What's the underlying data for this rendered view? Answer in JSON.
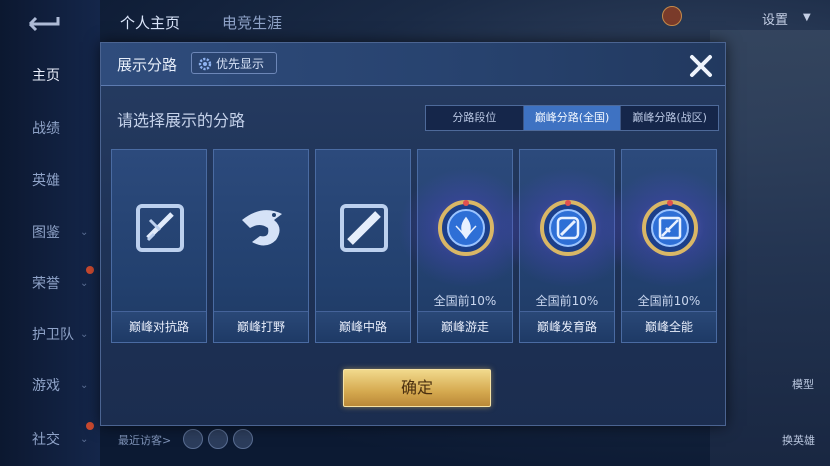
{
  "sidebar": {
    "items": [
      {
        "label": "主页",
        "active": true,
        "chevron": false,
        "dot": false
      },
      {
        "label": "战绩",
        "active": false,
        "chevron": false,
        "dot": false
      },
      {
        "label": "英雄",
        "active": false,
        "chevron": false,
        "dot": false
      },
      {
        "label": "图鉴",
        "active": false,
        "chevron": true,
        "dot": false
      },
      {
        "label": "荣誉",
        "active": false,
        "chevron": true,
        "dot": true
      },
      {
        "label": "护卫队",
        "active": false,
        "chevron": true,
        "dot": false
      },
      {
        "label": "游戏",
        "active": false,
        "chevron": true,
        "dot": false
      },
      {
        "label": "社交",
        "active": false,
        "chevron": true,
        "dot": true
      }
    ]
  },
  "top_tabs": [
    {
      "label": "个人主页",
      "active": true
    },
    {
      "label": "电竞生涯",
      "active": false
    }
  ],
  "settings_label": "设置",
  "bottom": {
    "visitors_label": "最近访客>"
  },
  "right_labels": {
    "model": "模型",
    "switch_hero": "换英雄"
  },
  "dialog": {
    "title": "展示分路",
    "priority_label": "优先显示",
    "prompt": "请选择展示的分路",
    "segments": [
      {
        "label": "分路段位",
        "active": false
      },
      {
        "label": "巅峰分路(全国)",
        "active": true
      },
      {
        "label": "巅峰分路(战区)",
        "active": false
      }
    ],
    "cards": [
      {
        "name": "巅峰对抗路",
        "rank": "",
        "icon": "clash-lane-icon",
        "badge": false
      },
      {
        "name": "巅峰打野",
        "rank": "",
        "icon": "jungle-dragon-icon",
        "badge": false
      },
      {
        "name": "巅峰中路",
        "rank": "",
        "icon": "mid-lane-icon",
        "badge": false
      },
      {
        "name": "巅峰游走",
        "rank": "全国前10%",
        "icon": "roam-badge-icon",
        "badge": true
      },
      {
        "name": "巅峰发育路",
        "rank": "全国前10%",
        "icon": "farm-lane-badge-icon",
        "badge": true
      },
      {
        "name": "巅峰全能",
        "rank": "全国前10%",
        "icon": "all-round-badge-icon",
        "badge": true
      }
    ],
    "confirm_label": "确定"
  },
  "colors": {
    "accent": "#3e72c2",
    "gold": "#d5a94f",
    "badge_glow": "#8f78ff"
  }
}
